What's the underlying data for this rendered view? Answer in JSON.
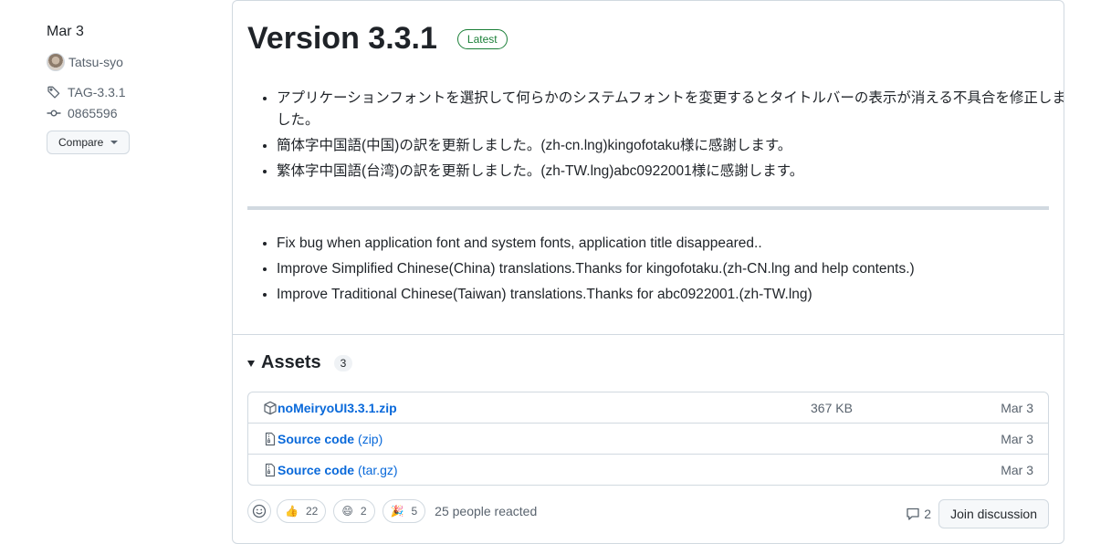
{
  "meta": {
    "date": "Mar 3",
    "author": "Tatsu-syo",
    "tag": "TAG-3.3.1",
    "commit": "0865596",
    "compare_label": "Compare"
  },
  "release": {
    "title": "Version 3.3.1",
    "latest_label": "Latest",
    "notes_jp": [
      "アプリケーションフォントを選択して何らかのシステムフォントを変更するとタイトルバーの表示が消える不具合を修正しました。",
      "簡体字中国語(中国)の訳を更新しました。(zh-cn.lng)kingofotaku様に感謝します。",
      "繁体字中国語(台湾)の訳を更新しました。(zh-TW.lng)abc0922001様に感謝します。"
    ],
    "notes_en": [
      "Fix bug when application font and system fonts, application title disappeared..",
      "Improve Simplified Chinese(China) translations.Thanks for kingofotaku.(zh-CN.lng and help contents.)",
      "Improve Traditional Chinese(Taiwan) translations.Thanks for abc0922001.(zh-TW.lng)"
    ]
  },
  "assets": {
    "heading": "Assets",
    "count": "3",
    "items": [
      {
        "name": "noMeiryoUI3.3.1.zip",
        "ext": "",
        "size": "367 KB",
        "date": "Mar 3",
        "icon": "package-icon"
      },
      {
        "name": "Source code",
        "ext": "(zip)",
        "size": "",
        "date": "Mar 3",
        "icon": "file-zip-icon"
      },
      {
        "name": "Source code",
        "ext": "(tar.gz)",
        "size": "",
        "date": "Mar 3",
        "icon": "file-zip-icon"
      }
    ]
  },
  "reactions": {
    "items": [
      {
        "emoji": "👍",
        "count": "22"
      },
      {
        "emoji": "😄",
        "count": "2"
      },
      {
        "emoji": "🎉",
        "count": "5"
      }
    ],
    "summary": "25 people reacted"
  },
  "discussion": {
    "comment_count": "2",
    "join_label": "Join discussion"
  },
  "colors": {
    "link": "#0969da",
    "latest_green": "#1a7f37",
    "border": "#d1d9e0",
    "muted": "#59636e"
  }
}
